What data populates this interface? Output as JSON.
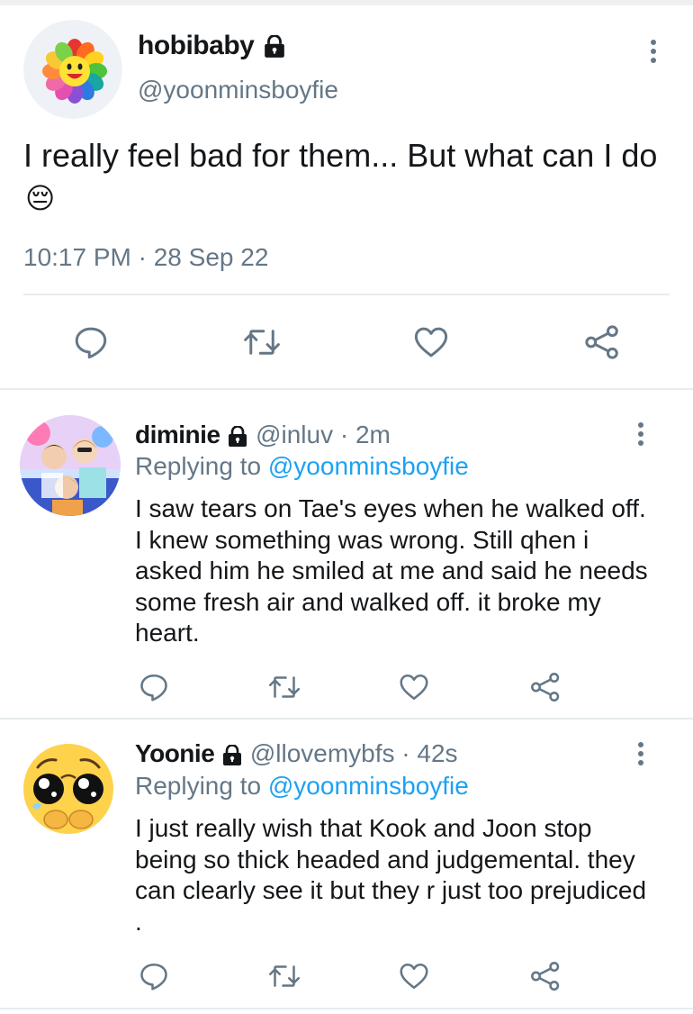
{
  "main_tweet": {
    "display_name": "hobibaby",
    "handle": "@yoonminsboyfie",
    "text": "I really feel bad for them... But what can I do",
    "emoji": "😔",
    "timestamp": "10:17 PM · 28 Sep 22",
    "avatar": "flower-smiley-avatar"
  },
  "replies": [
    {
      "display_name": "diminie",
      "handle": "@inluv",
      "time": "2m",
      "replying_prefix": "Replying to",
      "replying_to": "@yoonminsboyfie",
      "text": "I saw tears on Tae's eyes when he walked off. I knew something was wrong. Still qhen i asked him he smiled at me and said he needs some fresh air and walked off. it broke my heart.",
      "avatar": "group-photo-avatar"
    },
    {
      "display_name": "Yoonie",
      "handle": "@llovemybfs",
      "time": "42s",
      "replying_prefix": "Replying to",
      "replying_to": "@yoonminsboyfie",
      "text": "I just really wish that Kook and Joon stop being so thick headed and judgemental. they can clearly see it but they r just too prejudiced .",
      "avatar": "crying-emoji-avatar"
    }
  ],
  "separator": " · ",
  "colors": {
    "text": "#14171a",
    "secondary": "#657786",
    "link": "#1da1f2",
    "divider": "#e6ecf0"
  },
  "icons": [
    "lock-icon",
    "more-icon",
    "reply-icon",
    "retweet-icon",
    "like-icon",
    "share-icon"
  ]
}
